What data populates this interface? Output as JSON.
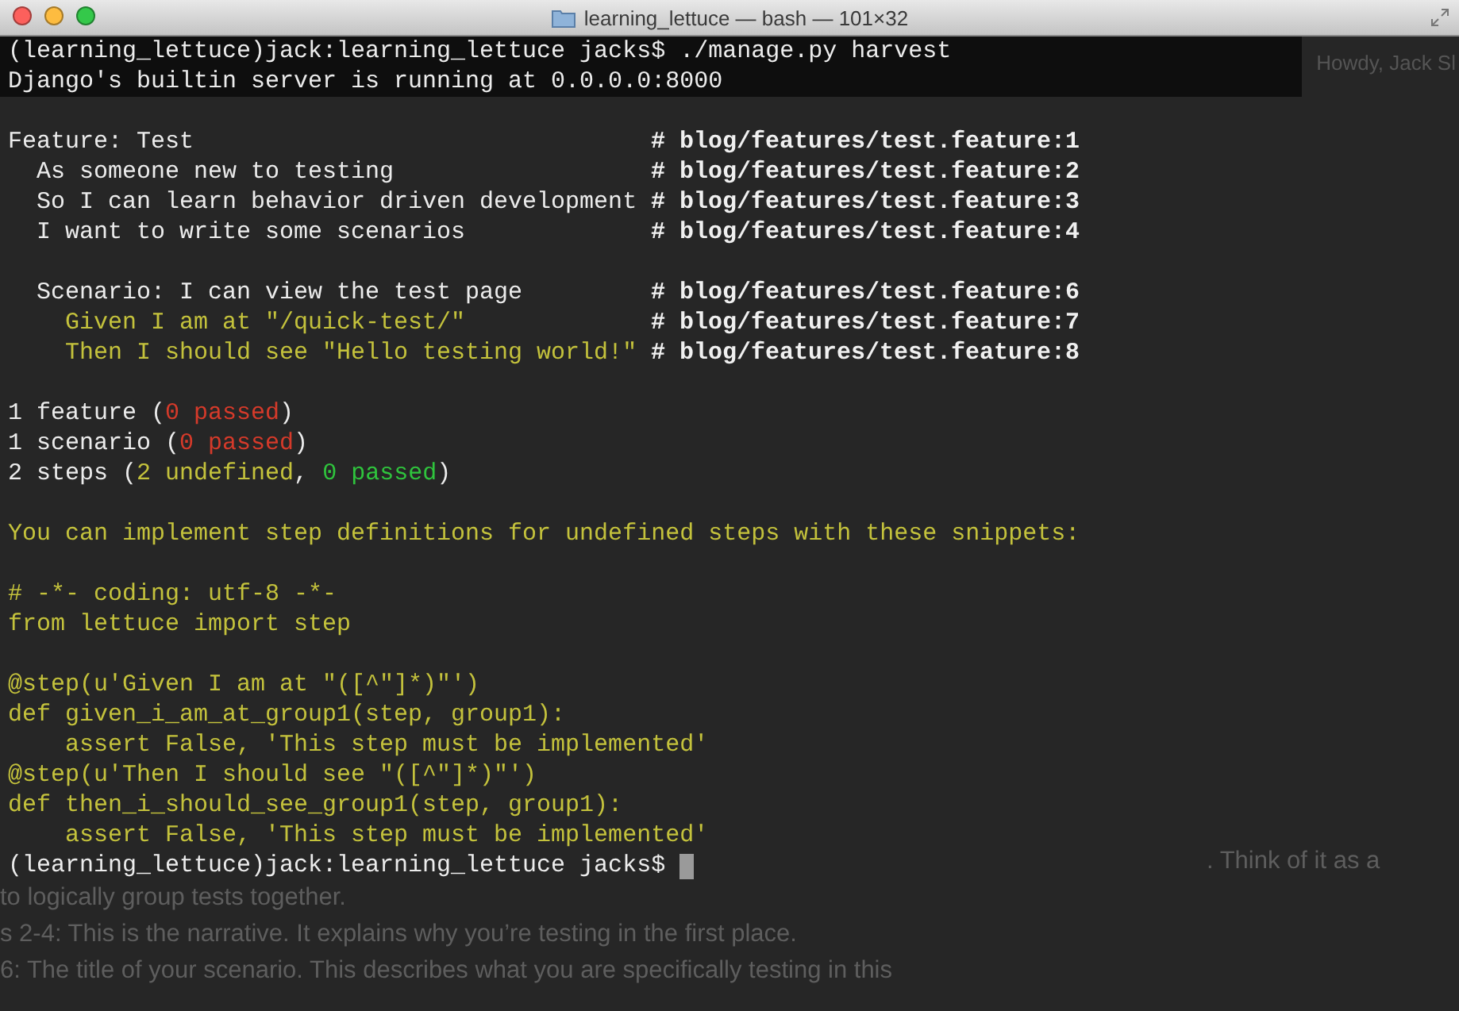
{
  "window": {
    "title": "learning_lettuce — bash — 101×32"
  },
  "background_page": {
    "greeting": "Howdy, Jack Sl",
    "lines": [
      {
        "kind": "tail",
        "text": ". Think of it as a"
      },
      {
        "kind": "line",
        "text": "to logically group tests together."
      },
      {
        "kind": "line",
        "text": "s 2-4: This is the narrative. It explains why you’re testing in the first place."
      },
      {
        "kind": "line",
        "text": "6: The title of your scenario. This describes what you are specifically testing in this"
      }
    ]
  },
  "terminal": {
    "lines": [
      {
        "kind": "text",
        "shaded": true,
        "segments": [
          {
            "color": "#ececec",
            "text": "(learning_lettuce)jack:learning_lettuce jacks$ ./manage.py harvest"
          }
        ]
      },
      {
        "kind": "text",
        "shaded": true,
        "segments": [
          {
            "color": "#ececec",
            "text": "Django's builtin server is running at 0.0.0.0:8000"
          }
        ]
      },
      {
        "kind": "blank"
      },
      {
        "kind": "text",
        "segments": [
          {
            "color": "#ececec",
            "text": "Feature: Test"
          }
        ],
        "comment": "# blog/features/test.feature:1"
      },
      {
        "kind": "text",
        "segments": [
          {
            "color": "#ececec",
            "text": "  As someone new to testing"
          }
        ],
        "comment": "# blog/features/test.feature:2"
      },
      {
        "kind": "text",
        "segments": [
          {
            "color": "#ececec",
            "text": "  So I can learn behavior driven development"
          }
        ],
        "comment": "# blog/features/test.feature:3"
      },
      {
        "kind": "text",
        "segments": [
          {
            "color": "#ececec",
            "text": "  I want to write some scenarios"
          }
        ],
        "comment": "# blog/features/test.feature:4"
      },
      {
        "kind": "blank"
      },
      {
        "kind": "text",
        "segments": [
          {
            "color": "#ececec",
            "text": "  Scenario: I can view the test page"
          }
        ],
        "comment": "# blog/features/test.feature:6"
      },
      {
        "kind": "text",
        "segments": [
          {
            "color": "#c4c23c",
            "text": "    Given I am at \"/quick-test/\""
          }
        ],
        "comment": "# blog/features/test.feature:7"
      },
      {
        "kind": "text",
        "segments": [
          {
            "color": "#c4c23c",
            "text": "    Then I should see \"Hello testing world!\""
          }
        ],
        "comment": "# blog/features/test.feature:8"
      },
      {
        "kind": "blank"
      },
      {
        "kind": "text",
        "segments": [
          {
            "color": "#ececec",
            "text": "1 feature ("
          },
          {
            "color": "#d53a2a",
            "text": "0 passed"
          },
          {
            "color": "#ececec",
            "text": ")"
          }
        ]
      },
      {
        "kind": "text",
        "segments": [
          {
            "color": "#ececec",
            "text": "1 scenario ("
          },
          {
            "color": "#d53a2a",
            "text": "0 passed"
          },
          {
            "color": "#ececec",
            "text": ")"
          }
        ]
      },
      {
        "kind": "text",
        "segments": [
          {
            "color": "#ececec",
            "text": "2 steps ("
          },
          {
            "color": "#c4c23c",
            "text": "2 undefined"
          },
          {
            "color": "#ececec",
            "text": ", "
          },
          {
            "color": "#2fc43d",
            "text": "0 passed"
          },
          {
            "color": "#ececec",
            "text": ")"
          }
        ]
      },
      {
        "kind": "blank"
      },
      {
        "kind": "text",
        "segments": [
          {
            "color": "#c4c23c",
            "text": "You can implement step definitions for undefined steps with these snippets:"
          }
        ]
      },
      {
        "kind": "blank"
      },
      {
        "kind": "text",
        "segments": [
          {
            "color": "#c4c23c",
            "text": "# -*- coding: utf-8 -*-"
          }
        ]
      },
      {
        "kind": "text",
        "segments": [
          {
            "color": "#c4c23c",
            "text": "from lettuce import step"
          }
        ]
      },
      {
        "kind": "blank"
      },
      {
        "kind": "text",
        "segments": [
          {
            "color": "#c4c23c",
            "text": "@step(u'Given I am at \"([^\"]*)\"')"
          }
        ]
      },
      {
        "kind": "text",
        "segments": [
          {
            "color": "#c4c23c",
            "text": "def given_i_am_at_group1(step, group1):"
          }
        ]
      },
      {
        "kind": "text",
        "segments": [
          {
            "color": "#c4c23c",
            "text": "    assert False, 'This step must be implemented'"
          }
        ]
      },
      {
        "kind": "text",
        "segments": [
          {
            "color": "#c4c23c",
            "text": "@step(u'Then I should see \"([^\"]*)\"')"
          }
        ]
      },
      {
        "kind": "text",
        "segments": [
          {
            "color": "#c4c23c",
            "text": "def then_i_should_see_group1(step, group1):"
          }
        ]
      },
      {
        "kind": "text",
        "segments": [
          {
            "color": "#c4c23c",
            "text": "    assert False, 'This step must be implemented'"
          }
        ]
      },
      {
        "kind": "prompt",
        "segments": [
          {
            "color": "#ececec",
            "text": "(learning_lettuce)jack:learning_lettuce jacks$ "
          }
        ]
      }
    ]
  }
}
